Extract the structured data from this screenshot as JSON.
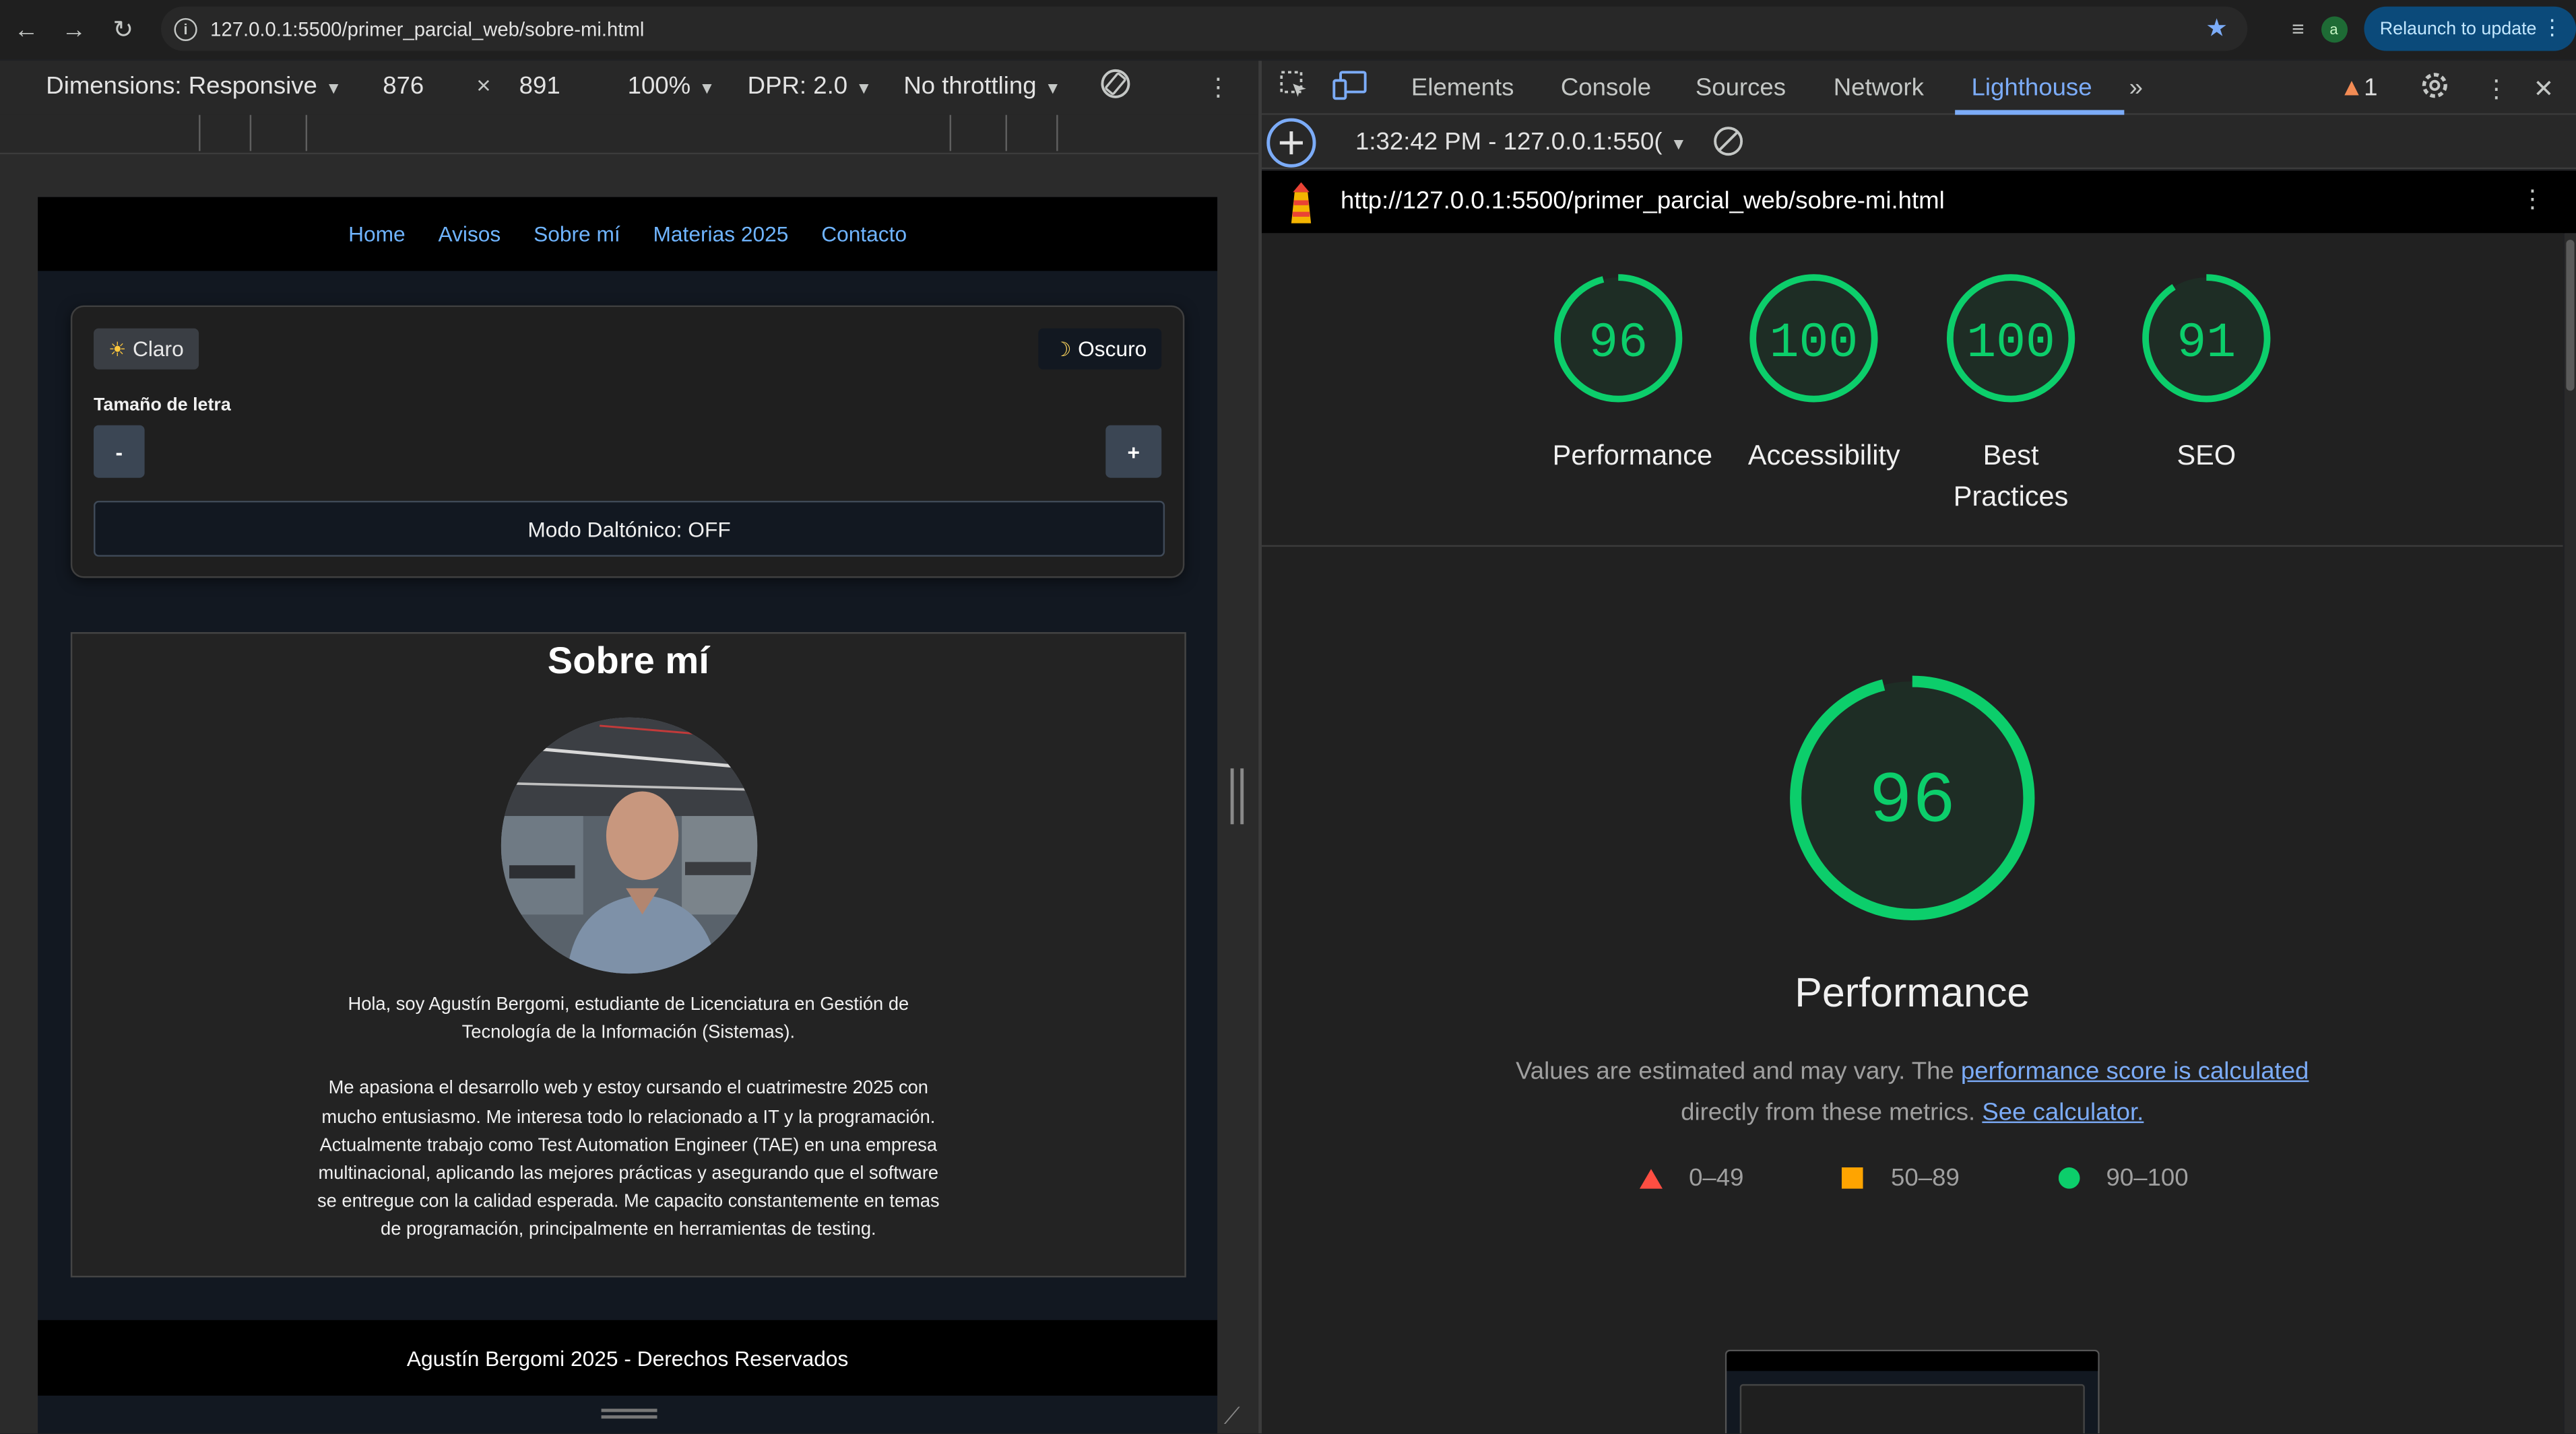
{
  "browser": {
    "url": "127.0.0.1:5500/primer_parcial_web/sobre-mi.html",
    "relaunch_label": "Relaunch to update",
    "profile_initial": "a"
  },
  "device_toolbar": {
    "dimensions_label": "Dimensions: Responsive",
    "width": "876",
    "times": "×",
    "height": "891",
    "zoom": "100%",
    "dpr": "DPR: 2.0",
    "throttling": "No throttling"
  },
  "site": {
    "nav": [
      "Home",
      "Avisos",
      "Sobre mí",
      "Materias 2025",
      "Contacto"
    ],
    "theme_light": "Claro",
    "theme_dark": "Oscuro",
    "font_size_label": "Tamaño de letra",
    "decrease": "-",
    "increase": "+",
    "colorblind_toggle": "Modo Daltónico: OFF",
    "heading": "Sobre mí",
    "paragraph_1": "Hola, soy Agustín Bergomi, estudiante de Licenciatura en Gestión de Tecnología de la Información (Sistemas).",
    "paragraph_2": "Me apasiona el desarrollo web y estoy cursando el cuatrimestre 2025 con mucho entusiasmo. Me interesa todo lo relacionado a IT y la programación. Actualmente trabajo como Test Automation Engineer (TAE) en una empresa multinacional, aplicando las mejores prácticas y asegurando que el software se entregue con la calidad esperada. Me capacito constantemente en temas de programación, principalmente en herramientas de testing.",
    "footer": "Agustín Bergomi 2025 - Derechos Reservados"
  },
  "devtools": {
    "tabs": [
      "Elements",
      "Console",
      "Sources",
      "Network",
      "Lighthouse"
    ],
    "active_tab": "Lighthouse",
    "warning_count": "1",
    "report_time": "1:32:42 PM - 127.0.0.1:550(",
    "report_url": "http://127.0.0.1:5500/primer_parcial_web/sobre-mi.html",
    "scores": [
      {
        "value": 96,
        "label": "Performance"
      },
      {
        "value": 100,
        "label": "Accessibility"
      },
      {
        "value": 100,
        "label": "Best Practices"
      },
      {
        "value": 91,
        "label": "SEO"
      }
    ],
    "performance": {
      "score": 96,
      "title": "Performance",
      "desc_prefix": "Values are estimated and may vary. The ",
      "desc_link1": "performance score is calculated",
      "desc_middle": " directly from these metrics. ",
      "desc_link2": "See calculator."
    },
    "legend": [
      {
        "range": "0–49",
        "color": "#ff4e42"
      },
      {
        "range": "50–89",
        "color": "#ffa400"
      },
      {
        "range": "90–100",
        "color": "#0cce6b"
      }
    ]
  },
  "colors": {
    "pass": "#0cce6b",
    "link": "#7cacf8",
    "site_link": "#6fb4ff"
  }
}
